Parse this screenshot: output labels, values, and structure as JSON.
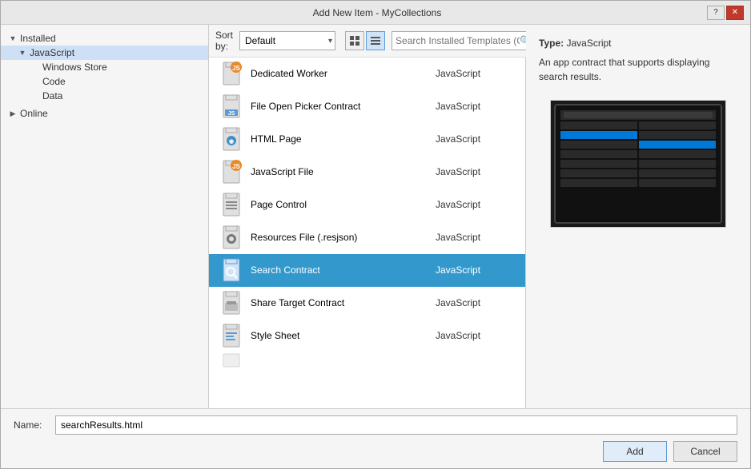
{
  "titleBar": {
    "title": "Add New Item - MyCollections",
    "helpBtn": "?",
    "closeBtn": "✕"
  },
  "sidebar": {
    "sections": [
      {
        "id": "installed",
        "label": "Installed",
        "expanded": true,
        "level": 0
      },
      {
        "id": "javascript",
        "label": "JavaScript",
        "expanded": true,
        "level": 1,
        "selected": true
      },
      {
        "id": "windowsstore",
        "label": "Windows Store",
        "level": 2
      },
      {
        "id": "code",
        "label": "Code",
        "level": 2
      },
      {
        "id": "data",
        "label": "Data",
        "level": 2
      },
      {
        "id": "online",
        "label": "Online",
        "expanded": false,
        "level": 0
      }
    ]
  },
  "toolbar": {
    "sortLabel": "Sort by:",
    "sortDefault": "Default",
    "searchPlaceholder": "Search Installed Templates (Ctrl+E)"
  },
  "fileList": {
    "items": [
      {
        "id": "dedicated-worker",
        "name": "Dedicated Worker",
        "type": "JavaScript",
        "iconType": "worker"
      },
      {
        "id": "file-open-picker",
        "name": "File Open Picker Contract",
        "type": "JavaScript",
        "iconType": "file-picker"
      },
      {
        "id": "html-page",
        "name": "HTML Page",
        "type": "JavaScript",
        "iconType": "html"
      },
      {
        "id": "javascript-file",
        "name": "JavaScript File",
        "type": "JavaScript",
        "iconType": "js"
      },
      {
        "id": "page-control",
        "name": "Page Control",
        "type": "JavaScript",
        "iconType": "page"
      },
      {
        "id": "resources-file",
        "name": "Resources File (.resjson)",
        "type": "JavaScript",
        "iconType": "gear"
      },
      {
        "id": "search-contract",
        "name": "Search Contract",
        "type": "JavaScript",
        "iconType": "search",
        "selected": true
      },
      {
        "id": "share-target",
        "name": "Share Target Contract",
        "type": "JavaScript",
        "iconType": "share"
      },
      {
        "id": "style-sheet",
        "name": "Style Sheet",
        "type": "JavaScript",
        "iconType": "css"
      },
      {
        "id": "more",
        "name": "...",
        "type": "",
        "iconType": "file"
      }
    ]
  },
  "rightPanel": {
    "typeLabel": "Type:",
    "typeValue": "JavaScript",
    "description": "An app contract that supports displaying search results.",
    "previewAlt": "Search contract preview"
  },
  "bottomBar": {
    "nameLabel": "Name:",
    "nameValue": "searchResults.html",
    "addButton": "Add",
    "cancelButton": "Cancel"
  }
}
